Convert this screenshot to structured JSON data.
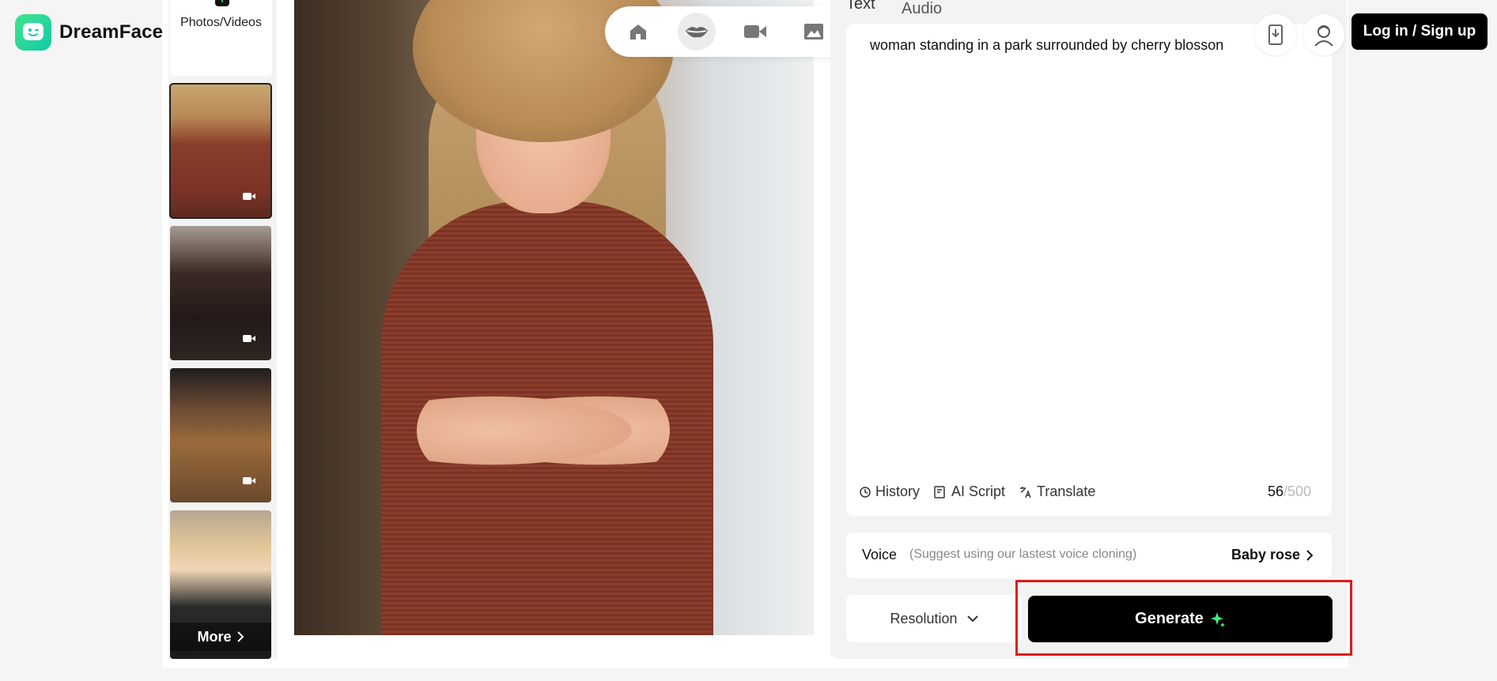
{
  "app": {
    "brand": "DreamFace"
  },
  "left_panel": {
    "upload_label": "Photos/Videos",
    "more_label": "More",
    "thumbnails": [
      {
        "selected": true
      },
      {
        "selected": false
      },
      {
        "selected": false
      },
      {
        "selected": false
      }
    ]
  },
  "toolbar": {
    "items": [
      "home-icon",
      "lips-icon",
      "video-camera-icon",
      "image-icon",
      "folder-icon"
    ],
    "active": "lips-icon"
  },
  "editor": {
    "tabs": {
      "text": "Text",
      "audio": "Audio"
    },
    "prompt_text": "woman standing in a park surrounded by cherry blosson",
    "tools": {
      "history": "History",
      "ai_script": "AI Script",
      "translate": "Translate"
    },
    "char_count": "56",
    "char_max": "/500",
    "voice": {
      "label": "Voice",
      "hint": "(Suggest using our lastest voice cloning)",
      "value": "Baby rose"
    },
    "resolution_label": "Resolution",
    "generate_label": "Generate"
  },
  "header": {
    "login_label": "Log in / Sign up"
  },
  "colors": {
    "accent_green": "#3bf07c",
    "highlight_red": "#e01b1b",
    "button_black": "#000000"
  }
}
